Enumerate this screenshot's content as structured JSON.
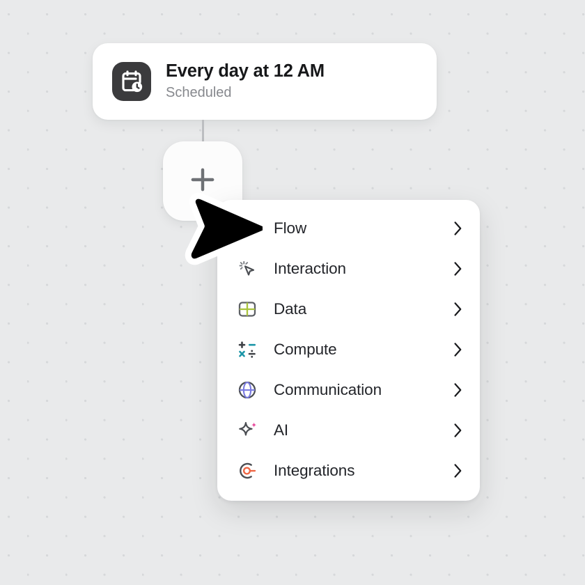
{
  "canvas": {
    "background_color": "#e9eaeb",
    "dot_color": "#d6d8da"
  },
  "trigger_node": {
    "icon": "calendar-clock-icon",
    "icon_background": "#3b3b3d",
    "title": "Every day at 12 AM",
    "subtitle": "Scheduled"
  },
  "add_button": {
    "icon": "plus-icon",
    "label": "+"
  },
  "cursor": {
    "icon": "mouse-pointer-cursor"
  },
  "menu": {
    "items": [
      {
        "label": "Flow",
        "icon": "flow-nodes-icon",
        "accent": "#6e7175",
        "chevron": "›"
      },
      {
        "label": "Interaction",
        "icon": "cursor-click-icon",
        "accent": "#4a4d52",
        "chevron": "›"
      },
      {
        "label": "Data",
        "icon": "data-table-icon",
        "accent": "#a9c33d",
        "chevron": "›"
      },
      {
        "label": "Compute",
        "icon": "math-ops-icon",
        "accent": "#1d96a8",
        "chevron": "›"
      },
      {
        "label": "Communication",
        "icon": "globe-icon",
        "accent": "#7b7ce0",
        "chevron": "›"
      },
      {
        "label": "AI",
        "icon": "sparkle-icon",
        "accent": "#e8479b",
        "chevron": "›"
      },
      {
        "label": "Integrations",
        "icon": "integrations-icon",
        "accent": "#ee6644",
        "chevron": "›"
      }
    ]
  }
}
